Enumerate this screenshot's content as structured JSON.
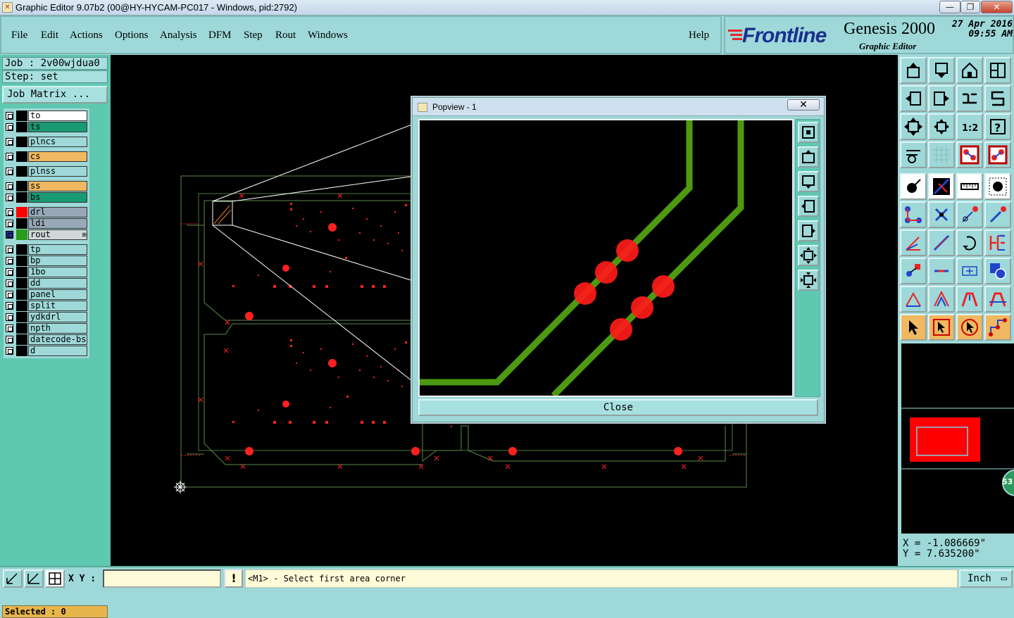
{
  "window": {
    "title": "Graphic Editor 9.07b2 (00@HY-HYCAM-PC017 - Windows, pid:2792)",
    "controls": [
      "—",
      "❐",
      "✕"
    ]
  },
  "menu": {
    "items": [
      {
        "label": "File"
      },
      {
        "label": "Edit"
      },
      {
        "label": "Actions"
      },
      {
        "label": "Options"
      },
      {
        "label": "Analysis"
      },
      {
        "label": "DFM"
      },
      {
        "label": "Step"
      },
      {
        "label": "Rout"
      },
      {
        "label": "Windows"
      }
    ],
    "help": "Help"
  },
  "brand": {
    "logo": "Frontline",
    "product": "Genesis 2000",
    "subtitle": "Graphic Editor",
    "date": "27 Apr 2016",
    "time": "09:55 AM"
  },
  "job": {
    "job_line": "Job : 2v00wjdua0",
    "step_line": "Step: set",
    "matrix_button": "Job Matrix ..."
  },
  "layers": [
    {
      "name": "to",
      "swatch": "#000000",
      "bg": "#ffffff",
      "checked": false
    },
    {
      "name": "ts",
      "swatch": "#000000",
      "bg": "#1a9a72",
      "checked": false
    },
    {
      "name": "plncs",
      "swatch": "#000000",
      "bg": "#9ed8d8",
      "checked": false
    },
    {
      "name": "cs",
      "swatch": "#000000",
      "bg": "#f0b860",
      "checked": false
    },
    {
      "name": "plnss",
      "swatch": "#000000",
      "bg": "#9ed8d8",
      "checked": false
    },
    {
      "name": "ss",
      "swatch": "#000000",
      "bg": "#f0b860",
      "checked": false
    },
    {
      "name": "bs",
      "swatch": "#000000",
      "bg": "#1a9a72",
      "checked": false
    },
    {
      "name": "drl",
      "swatch": "#ff0000",
      "bg": "#98a8b8",
      "checked": false
    },
    {
      "name": "ldi",
      "swatch": "#000000",
      "bg": "#98a8b8",
      "checked": false
    },
    {
      "name": "rout",
      "swatch": "#2c9a1a",
      "bg": "#d0d8d8",
      "checked": true,
      "active_marker": "⊞"
    },
    {
      "name": "tp",
      "swatch": "#000000",
      "bg": "#9ed8d8",
      "checked": false
    },
    {
      "name": "bp",
      "swatch": "#000000",
      "bg": "#9ed8d8",
      "checked": false
    },
    {
      "name": "1bo",
      "swatch": "#000000",
      "bg": "#9ed8d8",
      "checked": false
    },
    {
      "name": "dd",
      "swatch": "#000000",
      "bg": "#9ed8d8",
      "checked": false
    },
    {
      "name": "panel",
      "swatch": "#000000",
      "bg": "#9ed8d8",
      "checked": false
    },
    {
      "name": "split",
      "swatch": "#000000",
      "bg": "#9ed8d8",
      "checked": false
    },
    {
      "name": "ydkdrl",
      "swatch": "#000000",
      "bg": "#9ed8d8",
      "checked": false
    },
    {
      "name": "npth",
      "swatch": "#000000",
      "bg": "#9ed8d8",
      "checked": false
    },
    {
      "name": "datecode-bs",
      "swatch": "#000000",
      "bg": "#9ed8d8",
      "checked": false
    },
    {
      "name": "d",
      "swatch": "#000000",
      "bg": "#9ed8d8",
      "checked": false
    }
  ],
  "selected": "Selected : 0",
  "popview": {
    "title": "Popview - 1",
    "close_x": "✕",
    "close_button": "Close",
    "tools": [
      "zoom-fit-icon",
      "page-up-icon",
      "page-down-icon",
      "pan-left-icon",
      "pan-right-icon",
      "zoom-in-icon",
      "zoom-out-icon"
    ]
  },
  "toolbar": {
    "rows": [
      [
        "page-up-icon",
        "page-down-icon",
        "home-icon",
        "window-icon"
      ],
      [
        "pan-left-icon",
        "pan-right-icon",
        "swap-icon",
        "snake-icon"
      ],
      [
        "zoom-fit-icon",
        "center-icon",
        "scale-icon",
        "help-icon"
      ],
      [
        "measure-tool-icon",
        "grid-icon",
        "layers-red-icon",
        "layers-red-alt-icon"
      ],
      [
        "pad-icon",
        "line-icon",
        "ruler-icon",
        "dot-icon"
      ],
      [
        "connect-icon",
        "cross-icon",
        "arrow-point-icon",
        "arrow-point-alt-icon"
      ],
      [
        "angle-icon",
        "diagonal-icon",
        "rotate-icon",
        "fit-icon"
      ],
      [
        "move-icon",
        "cut-icon",
        "resize-icon",
        "shape-icon"
      ],
      [
        "triangle-icon",
        "triangle-alt-icon",
        "arch-icon",
        "arch-alt-icon"
      ],
      [
        "select-arrow-icon",
        "select-box-icon",
        "select-circle-icon",
        "select-path-icon"
      ]
    ],
    "scale_badge": "53"
  },
  "coords": {
    "x": "X = -1.086669\"",
    "y": "Y = 7.635200\""
  },
  "status": {
    "xy_label": "X Y :",
    "warn": "!",
    "message": "<M1> - Select first area corner",
    "unit": "Inch"
  }
}
